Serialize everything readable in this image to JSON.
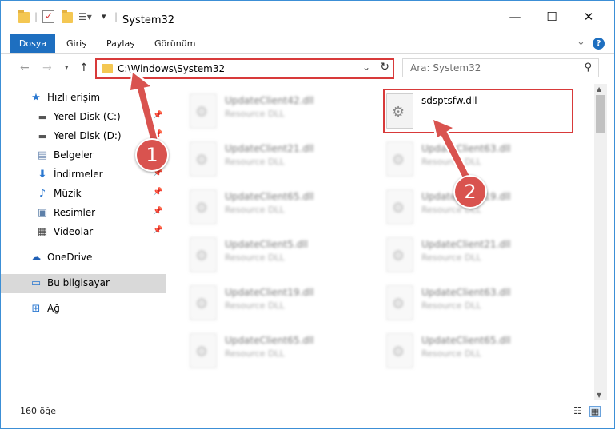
{
  "window": {
    "title": "System32",
    "minimize": "—",
    "maximize": "☐",
    "close": "✕"
  },
  "ribbon": {
    "tabs": [
      "Dosya",
      "Giriş",
      "Paylaş",
      "Görünüm"
    ],
    "collapse": "⌄",
    "help": "?"
  },
  "address": {
    "path": "C:\\Windows\\System32",
    "search_placeholder": "Ara: System32"
  },
  "nav": {
    "items": [
      {
        "label": "Hızlı erişim",
        "icon": "star-icon"
      },
      {
        "label": "Yerel Disk (C:)",
        "icon": "disk-icon"
      },
      {
        "label": "Yerel Disk (D:)",
        "icon": "disk-icon"
      },
      {
        "label": "Belgeler",
        "icon": "documents-icon"
      },
      {
        "label": "İndirmeler",
        "icon": "download-icon"
      },
      {
        "label": "Müzik",
        "icon": "music-icon"
      },
      {
        "label": "Resimler",
        "icon": "pictures-icon"
      },
      {
        "label": "Videolar",
        "icon": "videos-icon"
      },
      {
        "label": "OneDrive",
        "icon": "cloud-icon"
      },
      {
        "label": "Bu bilgisayar",
        "icon": "computer-icon"
      },
      {
        "label": "Ağ",
        "icon": "network-icon"
      }
    ]
  },
  "files": {
    "type_label": "Resource DLL",
    "left": [
      "UpdateClient42.dll",
      "UpdateClient21.dll",
      "UpdateClient65.dll",
      "UpdateClient5.dll",
      "UpdateClient19.dll",
      "UpdateClient65.dll"
    ],
    "right": [
      "sdsptsfw.dll",
      "UpdateClient63.dll",
      "UpdateClient19.dll",
      "UpdateClient21.dll",
      "UpdateClient63.dll",
      "UpdateClient65.dll"
    ]
  },
  "status": {
    "count": "160 öğe"
  },
  "annotations": {
    "step1": "1",
    "step2": "2",
    "color": "#d9534f"
  }
}
